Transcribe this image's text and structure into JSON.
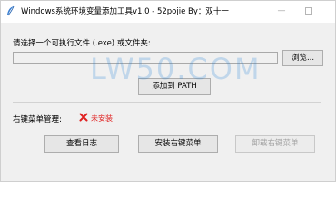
{
  "window": {
    "title": "Windows系统环境变量添加工具v1.0 - 52pojie By：双十一",
    "minimize_glyph": "—"
  },
  "main": {
    "select_label": "请选择一个可执行文件 (.exe) 或文件夹:",
    "path_value": "",
    "browse_label": "浏览...",
    "add_path_label": "添加到 PATH"
  },
  "context_menu": {
    "label": "右键菜单管理:",
    "status_text": "未安装",
    "status_icon": "cross-icon",
    "status_color": "#e02020",
    "view_log_label": "查看日志",
    "install_label": "安装右键菜单",
    "uninstall_label": "卸载右键菜单"
  },
  "watermark": {
    "text": "LW50.COM"
  }
}
